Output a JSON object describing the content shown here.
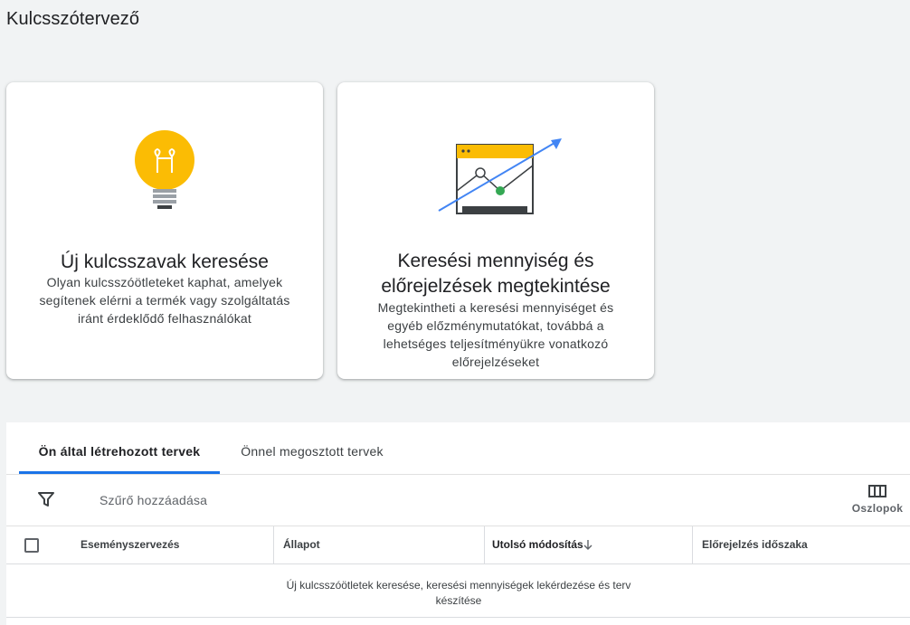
{
  "page": {
    "title": "Kulcsszótervező"
  },
  "cards": [
    {
      "title": "Új kulcsszavak keresése",
      "description": "Olyan kulcsszóötleteket kaphat, amelyek segítenek elérni a termék vagy szolgáltatás iránt érdeklődő felhasználókat",
      "icon": "lightbulb-icon"
    },
    {
      "title": "Keresési mennyiség és előrejelzések megtekintése",
      "description": "Megtekintheti a keresési mennyiséget és egyéb előzménymutatókat, továbbá a lehetséges teljesítményükre vonatkozó előrejelzéseket",
      "icon": "trend-chart-icon"
    }
  ],
  "tabs": [
    {
      "label": "Ön által létrehozott tervek",
      "active": true
    },
    {
      "label": "Önnel megosztott tervek",
      "active": false
    }
  ],
  "filter": {
    "label": "Szűrő hozzáadása",
    "icon": "filter-icon"
  },
  "columns_button": {
    "label": "Oszlopok",
    "icon": "columns-icon"
  },
  "table": {
    "headers": [
      "Eseményszervezés",
      "Állapot",
      "Utolsó módosítás",
      "Előrejelzés időszaka"
    ],
    "sort_icon": "arrow-down-icon",
    "empty_message": "Új kulcsszóötletek keresése, keresési mennyiségek lekérdezése és terv készítése"
  },
  "colors": {
    "accent": "#1a73e8",
    "bulb": "#fbbc04",
    "chart_green": "#34a853",
    "chart_arrow": "#4285f4"
  }
}
